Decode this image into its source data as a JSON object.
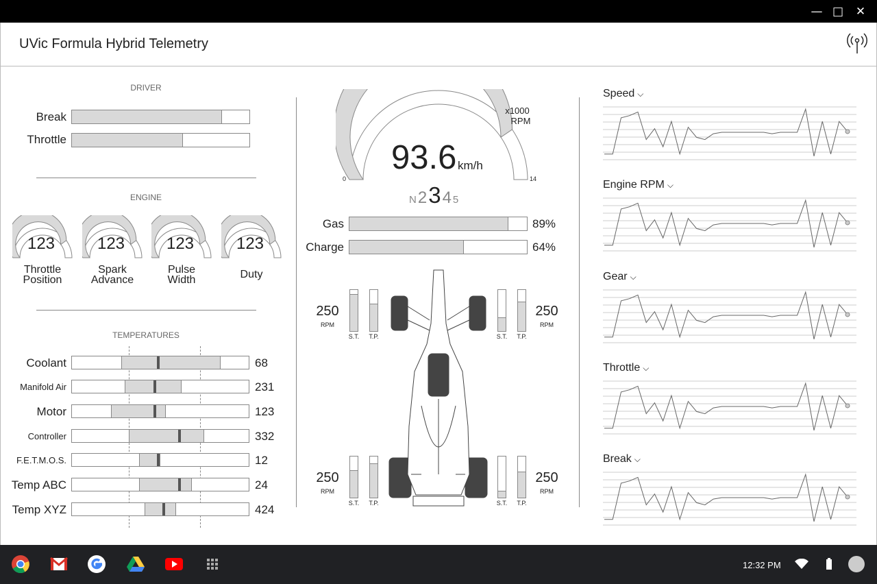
{
  "window": {
    "minimize_glyph": "—",
    "maximize_glyph": "□",
    "close_glyph": "✕"
  },
  "app": {
    "title": "UVic Formula Hybrid Telemetry",
    "icon": "telemetry-antenna-icon"
  },
  "driver": {
    "title": "DRIVER",
    "bars": [
      {
        "label": "Break",
        "fraction": 0.84
      },
      {
        "label": "Throttle",
        "fraction": 0.62
      }
    ]
  },
  "engine": {
    "title": "ENGINE",
    "gauges": [
      {
        "value": "123",
        "label_line1": "Throttle",
        "label_line2": "Position",
        "fraction": 0.8
      },
      {
        "value": "123",
        "label_line1": "Spark",
        "label_line2": "Advance",
        "fraction": 0.8
      },
      {
        "value": "123",
        "label_line1": "Pulse",
        "label_line2": "Width",
        "fraction": 0.8
      },
      {
        "value": "123",
        "label_line1": "Duty",
        "label_line2": "",
        "fraction": 0.8
      }
    ]
  },
  "temperatures": {
    "title": "TEMPERATURES",
    "rows": [
      {
        "label": "Coolant",
        "value": "68",
        "range_start": 0.28,
        "range_end": 0.84,
        "marker": 0.49
      },
      {
        "label": "Manifold Air",
        "value": "231",
        "range_start": 0.3,
        "range_end": 0.62,
        "marker": 0.47
      },
      {
        "label": "Motor",
        "value": "123",
        "range_start": 0.22,
        "range_end": 0.53,
        "marker": 0.47
      },
      {
        "label": "Controller",
        "value": "332",
        "range_start": 0.32,
        "range_end": 0.75,
        "marker": 0.61
      },
      {
        "label": "F.E.T.M.O.S.",
        "value": "12",
        "range_start": 0.38,
        "range_end": 0.5,
        "marker": 0.49
      },
      {
        "label": "Temp ABC",
        "value": "24",
        "range_start": 0.38,
        "range_end": 0.68,
        "marker": 0.61
      },
      {
        "label": "Temp XYZ",
        "value": "424",
        "range_start": 0.41,
        "range_end": 0.59,
        "marker": 0.52
      }
    ]
  },
  "speedometer": {
    "speed": "93.6",
    "unit": "km/h",
    "scale_label_1": "x1000",
    "scale_label_2": "RPM",
    "min": "0",
    "max": "14",
    "rpm_fraction": 0.81,
    "gears": [
      "N",
      "2",
      "3",
      "4",
      "5"
    ],
    "current_gear": "3"
  },
  "energy": [
    {
      "label": "Gas",
      "value": "89%",
      "fraction": 0.89
    },
    {
      "label": "Charge",
      "value": "64%",
      "fraction": 0.64
    }
  ],
  "wheels": {
    "front_left": {
      "rpm": "250",
      "unit": "RPM",
      "st_label": "S.T.",
      "tp_label": "T.P.",
      "st": 0.88,
      "tp": 0.65
    },
    "front_right": {
      "rpm": "250",
      "unit": "RPM",
      "st_label": "S.T.",
      "tp_label": "T.P.",
      "st": 0.32,
      "tp": 0.7
    },
    "rear_left": {
      "rpm": "250",
      "unit": "RPM",
      "st_label": "S.T.",
      "tp_label": "T.P.",
      "st": 0.65,
      "tp": 0.82
    },
    "rear_right": {
      "rpm": "250",
      "unit": "RPM",
      "st_label": "S.T.",
      "tp_label": "T.P.",
      "st": 0.15,
      "tp": 0.62
    }
  },
  "charts": [
    {
      "title": "Speed"
    },
    {
      "title": "Engine RPM"
    },
    {
      "title": "Gear"
    },
    {
      "title": "Throttle"
    },
    {
      "title": "Break"
    }
  ],
  "chart_data": {
    "type": "line",
    "x": [
      0,
      1,
      2,
      3,
      4,
      5,
      6,
      7,
      8,
      9,
      10,
      11,
      12,
      13,
      14,
      15,
      16,
      17,
      18,
      19,
      20,
      21,
      22,
      23,
      24,
      25,
      26,
      27,
      28,
      29
    ],
    "series_values": [
      5,
      5,
      55,
      58,
      63,
      25,
      40,
      15,
      50,
      5,
      42,
      28,
      25,
      33,
      35,
      35,
      35,
      35,
      35,
      35,
      33,
      35,
      35,
      35,
      67,
      2,
      50,
      5,
      50,
      36
    ],
    "ylim": [
      0,
      70
    ],
    "grid": true
  },
  "taskbar": {
    "apps": [
      "chrome-icon",
      "gmail-icon",
      "google-icon",
      "drive-icon",
      "youtube-icon",
      "app-launcher-icon"
    ],
    "time": "12:32 PM",
    "wifi_icon": "wifi-icon",
    "battery_icon": "battery-icon",
    "avatar_icon": "account-avatar"
  }
}
